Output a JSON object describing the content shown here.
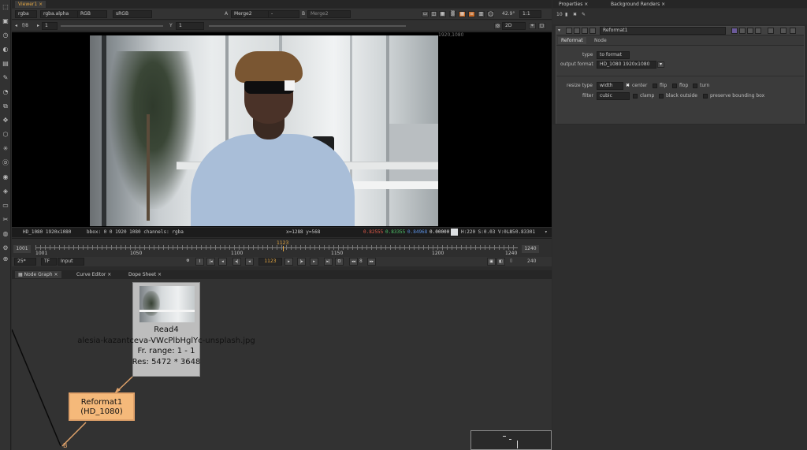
{
  "viewer": {
    "tab": "Viewer1",
    "channels": "rgba",
    "alpha_channel": "rgba.alpha",
    "color_mode": "RGB",
    "colorspace": "sRGB",
    "input_a_label": "A",
    "input_a": "Merge2",
    "input_a_op": "-",
    "input_b_label": "B",
    "input_b": "Merge2",
    "zoom": "42.9°",
    "ratio": "1:1",
    "fstop": "f/8",
    "frame_step": "1",
    "gamma_label": "Y",
    "gamma": "1",
    "view_mode": "2D",
    "format_label": "1920,1080"
  },
  "info_bar": {
    "format": "HD_1080 1920x1080",
    "bbox": "bbox: 0 0 1920 1080 channels: rgba",
    "coords": "x=1288 y=568",
    "r": "0.82555",
    "g": "0.83355",
    "b": "0.84968",
    "a": "0.00000",
    "hsv": "H:220 S:0.03 V:0.85",
    "luminance": "L: 0.83301",
    "colors": {
      "r": "#e35a4a",
      "g": "#4fc46a",
      "b": "#5a8fe0"
    }
  },
  "timeline": {
    "start": "1001",
    "end": "1240",
    "ticks": [
      "1001",
      "1050",
      "1100",
      "1150",
      "1200",
      "1240"
    ],
    "current_marker": "1123",
    "fps": "25*",
    "tf": "TF",
    "input": "Input",
    "frame": "1123",
    "increment": "8",
    "length": "240"
  },
  "node_graph": {
    "tabs": [
      "Node Graph",
      "Curve Editor",
      "Dope Sheet"
    ],
    "read_node": {
      "name": "Read4",
      "file": "alesia-kazantceva-VWcPlbHglYc-unsplash.jpg",
      "range": "Fr. range: 1 - 1",
      "res": "Res: 5472 * 3648"
    },
    "reformat_node": {
      "name": "Reformat1",
      "sub": "(HD_1080)"
    },
    "b_label": "B"
  },
  "properties": {
    "tabs": [
      "Properties",
      "Background Renders"
    ],
    "node_name": "Reformat1",
    "sub_tabs": [
      "Reformat",
      "Node"
    ],
    "type_label": "type",
    "type_value": "to format",
    "output_format_label": "output format",
    "output_format_value": "HD_1080 1920x1080",
    "resize_type_label": "resize type",
    "resize_type_value": "width",
    "center_label": "center",
    "flip_label": "flip",
    "flop_label": "flop",
    "turn_label": "turn",
    "filter_label": "filter",
    "filter_value": "cubic",
    "clamp_label": "clamp",
    "black_outside_label": "black outside",
    "preserve_bbox_label": "preserve bounding box"
  },
  "colors": {
    "accent": "#e2a542",
    "reformat_node": "#f5b97a",
    "read_node": "#bdbdbd"
  }
}
